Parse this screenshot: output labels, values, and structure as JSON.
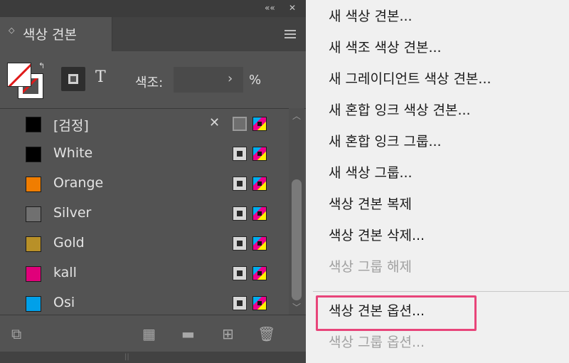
{
  "panel": {
    "title": "색상 견본",
    "topbar": {
      "collapse_glyph": "««",
      "close_glyph": "✕"
    },
    "tab_arrows": "◇",
    "tint": {
      "label": "색조:",
      "value": "",
      "unit": "%",
      "arrow": "›"
    },
    "apply_text_glyph": "T",
    "swatches": [
      {
        "name": "[검정]",
        "color": "#000000",
        "extra_icon": "✕",
        "type": "none"
      },
      {
        "name": "White",
        "color": "#000000",
        "type": "process"
      },
      {
        "name": "Orange",
        "color": "#f07d00",
        "type": "process"
      },
      {
        "name": "Silver",
        "color": "#707070",
        "type": "process"
      },
      {
        "name": "Gold",
        "color": "#b89028",
        "type": "process"
      },
      {
        "name": "kall",
        "color": "#e0007a",
        "type": "process"
      },
      {
        "name": "Osi",
        "color": "#00a0e9",
        "type": "process"
      }
    ],
    "scroll": {
      "up": "︿",
      "down": "﹀"
    },
    "bottom_icons": [
      {
        "name": "show-all-swatches-icon",
        "glyph": "⧉"
      },
      {
        "name": "swatch-views-icon",
        "glyph": "▦"
      },
      {
        "name": "new-color-group-icon",
        "glyph": "▬"
      },
      {
        "name": "new-swatch-icon",
        "glyph": "⊞"
      },
      {
        "name": "delete-swatch-icon",
        "glyph": "🗑"
      }
    ],
    "footer_grip": "||"
  },
  "menu": {
    "items": [
      {
        "label": "새 색상 견본...",
        "enabled": true
      },
      {
        "label": "새 색조 색상 견본...",
        "enabled": true
      },
      {
        "label": "새 그레이디언트 색상 견본...",
        "enabled": true
      },
      {
        "label": "새 혼합 잉크 색상 견본...",
        "enabled": true
      },
      {
        "label": "새 혼합 잉크 그룹...",
        "enabled": true
      },
      {
        "label": "새 색상 그룹...",
        "enabled": true
      },
      {
        "label": "색상 견본 복제",
        "enabled": true
      },
      {
        "label": "색상 견본 삭제...",
        "enabled": true
      },
      {
        "label": "색상 그룹 해제",
        "enabled": false
      },
      {
        "label": "색상 견본 옵션...",
        "enabled": true
      },
      {
        "label": "색상 그룹 옵션...",
        "enabled": false
      }
    ],
    "highlight_color": "#e8457a"
  }
}
